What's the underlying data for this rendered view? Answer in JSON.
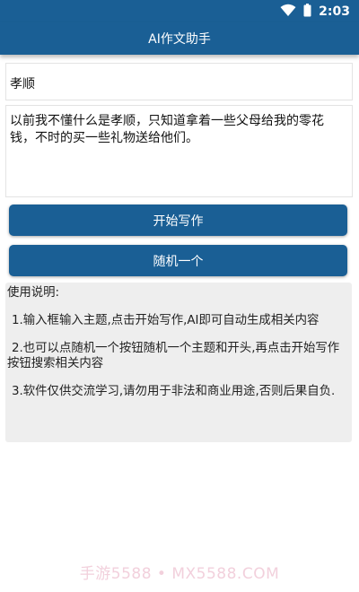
{
  "status_bar": {
    "time": "2:03",
    "icons": [
      "wifi-icon",
      "battery-icon"
    ]
  },
  "app_bar": {
    "title": "AI作文助手"
  },
  "topic_input": {
    "value": "孝顺"
  },
  "content_area": {
    "value": "以前我不懂什么是孝顺，只知道拿着一些父母给我的零花钱，不时的买一些礼物送给他们。"
  },
  "buttons": {
    "start_writing": "开始写作",
    "random_one": "随机一个"
  },
  "instructions": {
    "title": "使用说明:",
    "items": [
      "1.输入框输入主题,点击开始写作,AI即可自动生成相关内容",
      "2.也可以点随机一个按钮随机一个主题和开头,再点击开始写作按钮搜索相关内容",
      "3.软件仅供交流学习,请勿用于非法和商业用途,否则后果自负."
    ]
  },
  "watermark": "手游5588 • MX5588.COM",
  "colors": {
    "primary": "#1a5f95",
    "instructions_bg": "#eeeeee",
    "watermark": "#f2d0dc"
  }
}
